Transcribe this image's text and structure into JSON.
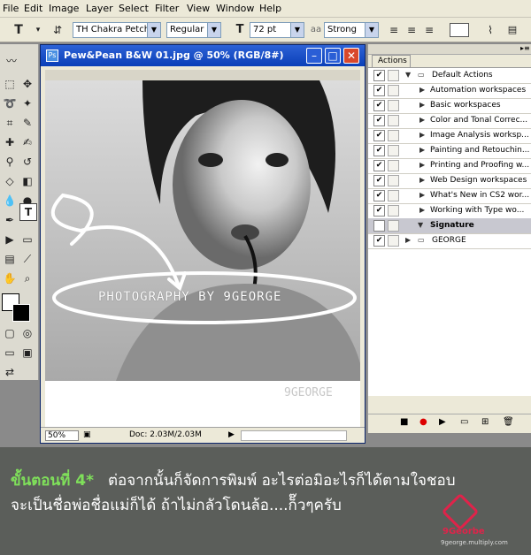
{
  "menu": [
    "File",
    "Edit",
    "Image",
    "Layer",
    "Select",
    "Filter",
    "View",
    "Window",
    "Help"
  ],
  "options": {
    "font_family": "TH Chakra Petch",
    "font_style": "Regular",
    "font_size": "72 pt",
    "antialias": "Strong"
  },
  "document": {
    "title": "Pew&Pean B&W 01.jpg @ 50% (RGB/8#)",
    "zoom": "50%",
    "doc_info": "Doc: 2.03M/2.03M",
    "overlay_text": "PHOTOGRAPHY BY 9GEORGE",
    "corner_watermark": "9GEORGE"
  },
  "actions_panel": {
    "tab": "Actions",
    "items": [
      {
        "label": "Default Actions",
        "kind": "folder",
        "expanded": true,
        "checked": true
      },
      {
        "label": "Automation workspaces",
        "kind": "action",
        "checked": true
      },
      {
        "label": "Basic workspaces",
        "kind": "action",
        "checked": true
      },
      {
        "label": "Color and Tonal Correc...",
        "kind": "action",
        "checked": true
      },
      {
        "label": "Image Analysis worksp...",
        "kind": "action",
        "checked": true
      },
      {
        "label": "Painting and Retouchin...",
        "kind": "action",
        "checked": true
      },
      {
        "label": "Printing and Proofing w...",
        "kind": "action",
        "checked": true
      },
      {
        "label": "Web Design workspaces",
        "kind": "action",
        "checked": true
      },
      {
        "label": "What's New in CS2 wor...",
        "kind": "action",
        "checked": true
      },
      {
        "label": "Working with Type wo...",
        "kind": "action",
        "checked": true
      },
      {
        "label": "Signature",
        "kind": "action",
        "expanded": true,
        "checked": false,
        "selected": true
      },
      {
        "label": "GEORGE",
        "kind": "folder",
        "checked": true
      }
    ]
  },
  "caption": {
    "step": "ขั้นตอนที่ 4*",
    "line1": "ต่อจากนั้นก็จัดการพิมพ์ อะไรต่อมิอะไรก็ได้ตามใจชอบ",
    "line2": "จะเป็นชื่อพ่อชื่อแม่ก็ได้ ถ้าไม่กลัวโดนล้อ....ก็๊วๆครับ",
    "logo_text": "9Georbe",
    "site": "9george.multiply.com"
  },
  "colors": {
    "step_green": "#7fe05a",
    "title_blue": "#0a3fb8",
    "logo_red": "#e0234a"
  }
}
